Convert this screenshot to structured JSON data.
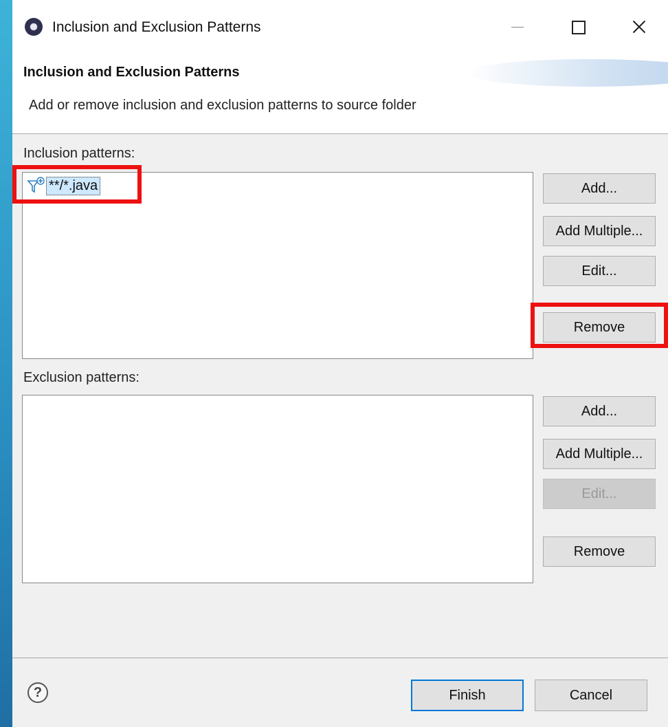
{
  "window": {
    "title": "Inclusion and Exclusion Patterns",
    "controls": {
      "minimize": "minimize",
      "maximize": "maximize",
      "close": "close"
    }
  },
  "banner": {
    "title": "Inclusion and Exclusion Patterns",
    "description": "Add or remove inclusion and exclusion patterns to source folder"
  },
  "inclusion": {
    "label": "Inclusion patterns:",
    "items": [
      {
        "icon": "filter-icon",
        "text": "**/*.java",
        "selected": true
      }
    ],
    "buttons": {
      "add": "Add...",
      "add_multiple": "Add Multiple...",
      "edit": "Edit...",
      "remove": "Remove"
    }
  },
  "exclusion": {
    "label": "Exclusion patterns:",
    "items": [],
    "buttons": {
      "add": "Add...",
      "add_multiple": "Add Multiple...",
      "edit": "Edit...",
      "edit_enabled": false,
      "remove": "Remove"
    }
  },
  "footer": {
    "help_icon": "help-icon",
    "finish": "Finish",
    "cancel": "Cancel"
  },
  "colors": {
    "highlight": "#ee1111",
    "selection": "#cde8ff",
    "default_button_border": "#0078d7"
  }
}
